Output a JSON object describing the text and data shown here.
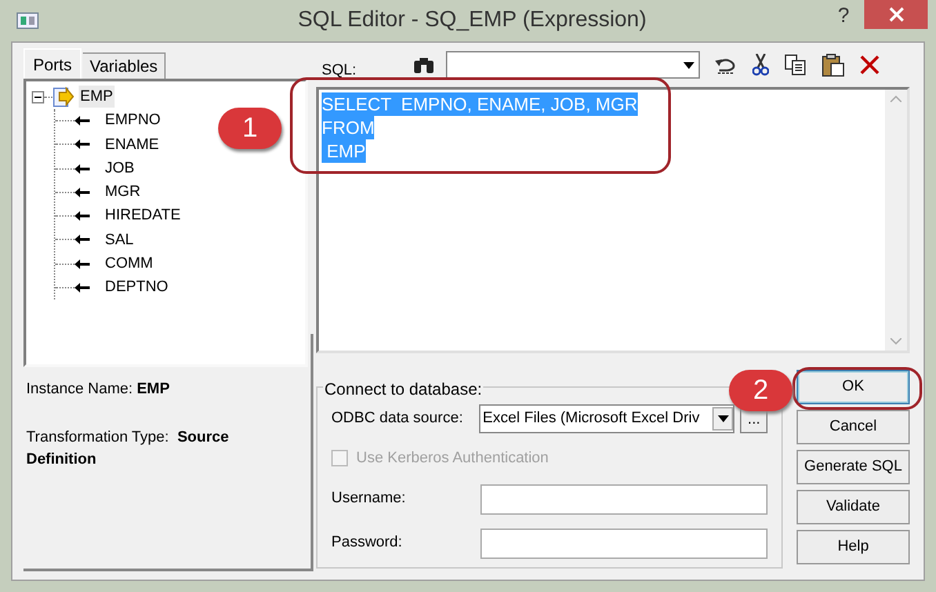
{
  "window": {
    "title": "SQL Editor - SQ_EMP (Expression)",
    "help": "?"
  },
  "tabs": [
    {
      "label": "Ports",
      "selected": true
    },
    {
      "label": "Variables",
      "selected": false
    }
  ],
  "tree": [
    {
      "label": "EMP",
      "expanded": true,
      "children": [
        {
          "label": "EMPNO"
        },
        {
          "label": "ENAME"
        },
        {
          "label": "JOB"
        },
        {
          "label": "MGR"
        },
        {
          "label": "HIREDATE"
        },
        {
          "label": "SAL"
        },
        {
          "label": "COMM"
        },
        {
          "label": "DEPTNO"
        }
      ]
    }
  ],
  "instance": {
    "label": "Instance Name:",
    "value": "EMP"
  },
  "transformation": {
    "label": "Transformation Type:",
    "value": "Source Definition"
  },
  "sql": {
    "label": "SQL:",
    "lines": [
      "SELECT  EMPNO, ENAME, JOB, MGR",
      "FROM",
      " EMP"
    ],
    "selected": true
  },
  "connect": {
    "title": "Connect to database:",
    "odbc_label": "ODBC data source:",
    "odbc_value": "Excel Files (Microsoft Excel Driv",
    "browse": "...",
    "kerberos": {
      "label": "Use Kerberos Authentication",
      "checked": false,
      "disabled": true
    },
    "username_label": "Username:",
    "password_label": "Password:"
  },
  "buttons": [
    {
      "label": "OK",
      "highlighted": true
    },
    {
      "label": "Cancel",
      "highlighted": false
    },
    {
      "label": "Generate SQL",
      "highlighted": false
    },
    {
      "label": "Validate",
      "highlighted": false
    },
    {
      "label": "Help",
      "highlighted": false
    }
  ],
  "callouts": [
    "1",
    "2"
  ]
}
